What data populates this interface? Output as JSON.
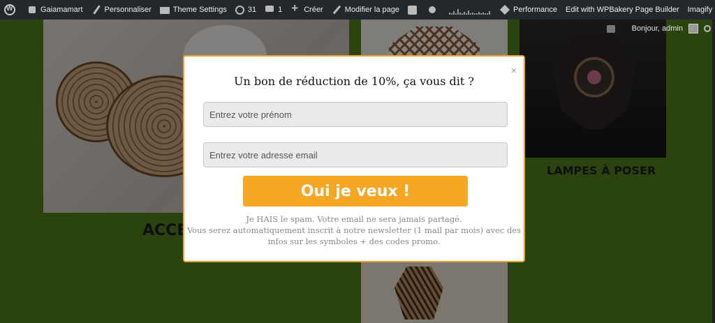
{
  "adminbar": {
    "site_name": "Gaiamamart",
    "customize": "Personnaliser",
    "theme_settings": "Theme Settings",
    "updates_count": "31",
    "comments_count": "1",
    "create": "Créer",
    "edit_page": "Modifier la page",
    "performance": "Performance",
    "wpbakery": "Edit with WPBakery Page Builder",
    "imagify": "Imagify",
    "greeting": "Bonjour, admin"
  },
  "page": {
    "tile_accessoires_title": "ACCESSOIRES",
    "tile_lampes_title": "LAMPES À POSER"
  },
  "popup": {
    "title": "Un bon de réduction de 10%, ça vous dit ?",
    "firstname_placeholder": "Entrez votre prénom",
    "email_placeholder": "Entrez votre adresse email",
    "submit_label": "Oui je veux !",
    "close_label": "×",
    "note_line1": "Je HAIS le spam. Votre email ne sera jamais partagé.",
    "note_line2": "Vous serez automatiquement inscrit à notre newsletter (1 mail par mois) avec des",
    "note_line3": "infos sur les symboles + des codes promo."
  },
  "colors": {
    "accent_orange": "#f5a623",
    "page_green": "#4d7a1c",
    "adminbar_bg": "#23282d"
  }
}
